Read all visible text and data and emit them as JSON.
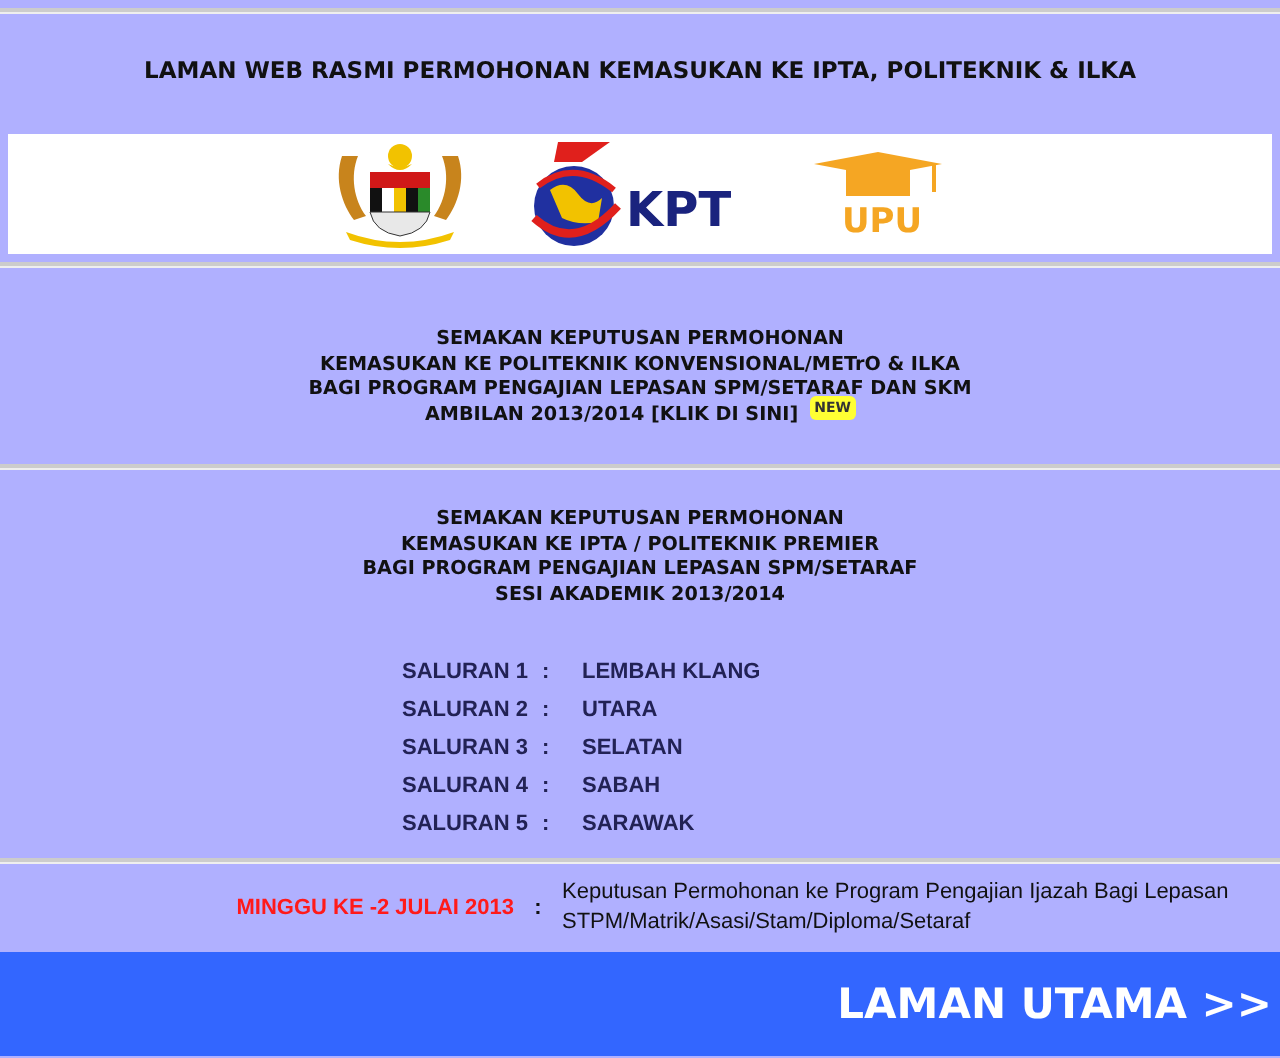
{
  "title": "LAMAN WEB RASMI PERMOHONAN KEMASUKAN KE IPTA, POLITEKNIK & ILKA",
  "logos": [
    {
      "kind": "crest"
    },
    {
      "kind": "kpt",
      "text": "KPT"
    },
    {
      "kind": "upu",
      "text": "UPU"
    }
  ],
  "notices": [
    {
      "lines": [
        "SEMAKAN KEPUTUSAN PERMOHONAN",
        "KEMASUKAN KE POLITEKNIK KONVENSIONAL/METrO & ILKA",
        "BAGI PROGRAM PENGAJIAN LEPASAN SPM/SETARAF DAN SKM",
        "AMBILAN 2013/2014 [KLIK DI SINI]"
      ],
      "badge": "NEW"
    },
    {
      "lines": [
        "SEMAKAN KEPUTUSAN PERMOHONAN",
        "KEMASUKAN KE IPTA / POLITEKNIK PREMIER",
        "BAGI PROGRAM PENGAJIAN LEPASAN SPM/SETARAF",
        "SESI AKADEMIK 2013/2014"
      ],
      "channels": [
        {
          "label": "SALURAN 1",
          "sep": ":",
          "value": "LEMBAH KLANG"
        },
        {
          "label": "SALURAN 2",
          "sep": ":",
          "value": "UTARA"
        },
        {
          "label": "SALURAN 3",
          "sep": ":",
          "value": "SELATAN"
        },
        {
          "label": "SALURAN 4",
          "sep": ":",
          "value": "SABAH"
        },
        {
          "label": "SALURAN 5",
          "sep": ":",
          "value": "SARAWAK"
        }
      ]
    }
  ],
  "schedule": {
    "date": "MINGGU KE -2 JULAI 2013",
    "sep": ":",
    "text": "Keputusan Permohonan ke Program Pengajian Ijazah Bagi Lepasan STPM/Matrik/Asasi/Stam/Diploma/Setaraf"
  },
  "home_link": "LAMAN UTAMA >>"
}
